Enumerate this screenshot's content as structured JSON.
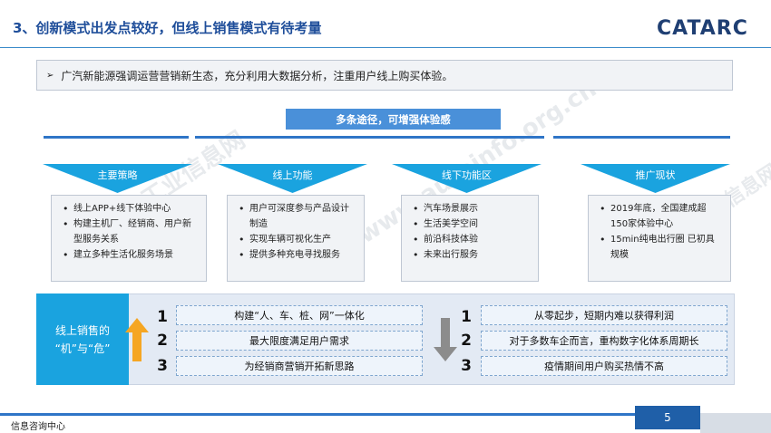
{
  "title": "3、创新模式出发点较好，但线上销售模式有待考量",
  "logo_text": "CATARC",
  "intro": {
    "marker": "➢",
    "text": "广汽新能源强调运营营销新生态，充分利用大数据分析，注重用户线上购买体验。"
  },
  "banner": "多条途径，可增强体验感",
  "columns": [
    {
      "header": "主要策略",
      "items": [
        "线上APP+线下体验中心",
        "构建主机厂、经销商、用户新型服务关系",
        "建立多种生活化服务场景"
      ]
    },
    {
      "header": "线上功能",
      "items": [
        "用户可深度参与产品设计制造",
        "实现车辆可视化生产",
        "提供多种充电寻找服务"
      ]
    },
    {
      "header": "线下功能区",
      "items": [
        "汽车场景展示",
        "生活美学空间",
        "前沿科技体验",
        "未来出行服务"
      ]
    },
    {
      "header": "推广现状",
      "items": [
        "2019年底，全国建成超150家体验中心",
        "15min纯电出行圈  已初具规模"
      ]
    }
  ],
  "sidebar": {
    "line1": "线上销售的",
    "line2": "“机”与“危”"
  },
  "opportunities": {
    "numbers": [
      "1",
      "2",
      "3"
    ],
    "items": [
      "构建“人、车、桩、网”一体化",
      "最大限度满足用户需求",
      "为经销商营销开拓新思路"
    ],
    "arrow_color": "#F5A623"
  },
  "risks": {
    "numbers": [
      "1",
      "2",
      "3"
    ],
    "items": [
      "从零起步，短期内难以获得利润",
      "对于多数车企而言，重构数字化体系周期长",
      "疫情期间用户购买热情不高"
    ],
    "arrow_color": "#8C8C8C"
  },
  "watermark": {
    "text1": "中国汽车工业信息网",
    "text2": "www.autoinfo.org.cn",
    "text3": "中国汽车工业信息网"
  },
  "footer": {
    "org": "信息咨询中心",
    "page": "5"
  },
  "colors": {
    "title": "#1F4E9A",
    "accent": "#2F75C7",
    "header_fill": "#1AA3DF",
    "banner": "#4A90D9"
  }
}
